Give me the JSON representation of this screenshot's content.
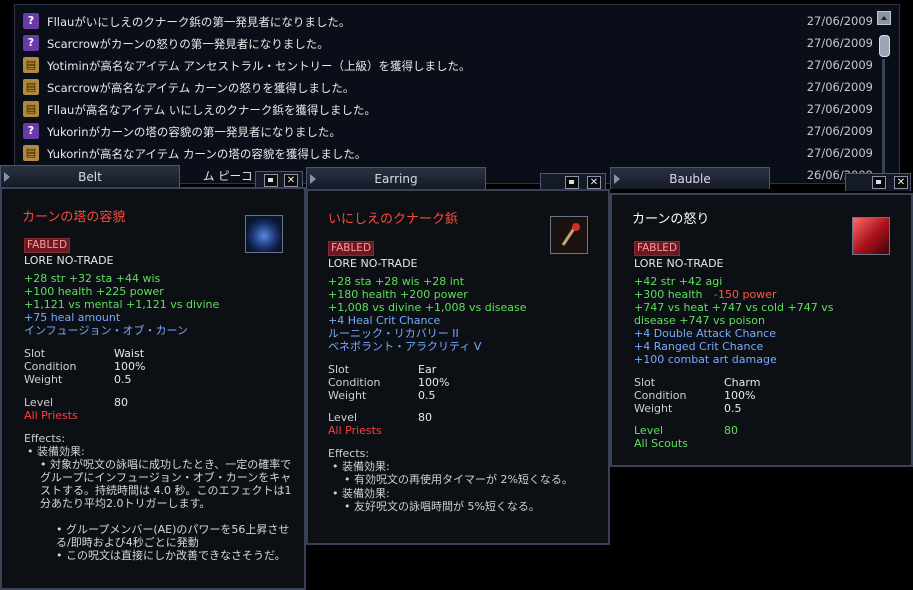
{
  "chat": {
    "rows": [
      {
        "icon": "quest",
        "text": "Fllauがいにしえのクナーク鋲の第一発見者になりました。",
        "date": "27/06/2009"
      },
      {
        "icon": "quest",
        "text": "Scarcrowがカーンの怒りの第一発見者になりました。",
        "date": "27/06/2009"
      },
      {
        "icon": "book",
        "text": "Yotiminが高名なアイテム アンセストラル・セントリー（上級）を獲得しました。",
        "date": "27/06/2009"
      },
      {
        "icon": "book",
        "text": "Scarcrowが高名なアイテム カーンの怒りを獲得しました。",
        "date": "27/06/2009"
      },
      {
        "icon": "book",
        "text": "Fllauが高名なアイテム いにしえのクナーク鋲を獲得しました。",
        "date": "27/06/2009"
      },
      {
        "icon": "quest",
        "text": "Yukorinがカーンの塔の容貌の第一発見者になりました。",
        "date": "27/06/2009"
      },
      {
        "icon": "book",
        "text": "Yukorinが高名なアイテム カーンの塔の容貌を獲得しました。",
        "date": "27/06/2009"
      },
      {
        "icon": "book",
        "text": "ム ピーコ",
        "date": "26/06/2009"
      }
    ]
  },
  "belt": {
    "title": "Belt",
    "name": "カーンの塔の容貌",
    "fabled": "FABLED",
    "lore": "LORE  NO-TRADE",
    "stats1": "+28 str  +32 sta  +44 wis",
    "stats2": "+100 health  +225 power",
    "stats3": "+1,121 vs mental  +1,121 vs divine",
    "stats4": "+75 heal amount",
    "spell": "インフュージョン・オブ・カーン",
    "slot_label": "Slot",
    "slot_value": "Waist",
    "cond_label": "Condition",
    "cond_value": "100%",
    "weight_label": "Weight",
    "weight_value": "0.5",
    "level_label": "Level",
    "level_value": "80",
    "classes": "All Priests",
    "effects_label": "Effects:",
    "effect_head": "• 装備効果:",
    "effect_1": "• 対象が呪文の詠唱に成功したとき、一定の確率でグループにインフュージョン・オブ・カーンをキャストする。持続時間は 4.0 秒。このエフェクトは1分あたり平均2.0トリガーします。",
    "effect_2": "• グループメンバー(AE)のパワーを56上昇させる/即時および4秒ごとに発動",
    "effect_3": "• この呪文は直接にしか改善できなさそうだ。"
  },
  "earring": {
    "title": "Earring",
    "name": "いにしえのクナーク鋲",
    "fabled": "FABLED",
    "lore": "LORE  NO-TRADE",
    "stats1": "+28 sta  +28 wis  +28 int",
    "stats2": "+180 health  +200 power",
    "stats3": "+1,008 vs divine  +1,008 vs disease",
    "stats4": "+4 Heal Crit Chance",
    "spell1": "ルーニック・リカバリー II",
    "spell2": "ベネボラント・アラクリティ V",
    "slot_label": "Slot",
    "slot_value": "Ear",
    "cond_label": "Condition",
    "cond_value": "100%",
    "weight_label": "Weight",
    "weight_value": "0.5",
    "level_label": "Level",
    "level_value": "80",
    "classes": "All Priests",
    "effects_label": "Effects:",
    "effect_head1": "• 装備効果:",
    "effect_1": "• 有効呪文の再使用タイマーが 2%短くなる。",
    "effect_head2": "• 装備効果:",
    "effect_2": "• 友好呪文の詠唱時間が 5%短くなる。"
  },
  "bauble": {
    "title": "Bauble",
    "name": "カーンの怒り",
    "fabled": "FABLED",
    "lore": "LORE  NO-TRADE",
    "stats1a": "+42 str  +42 agi",
    "stats2a": "+300 health",
    "stats2b": "-150 power",
    "stats3": "+747 vs heat  +747 vs cold  +747 vs",
    "stats4": "disease  +747 vs poison",
    "stats5": "+4 Double Attack Chance",
    "stats6": "+4 Ranged Crit Chance",
    "stats7": "+100 combat art damage",
    "slot_label": "Slot",
    "slot_value": "Charm",
    "cond_label": "Condition",
    "cond_value": "100%",
    "weight_label": "Weight",
    "weight_value": "0.5",
    "level_label": "Level",
    "level_value": "80",
    "classes": "All Scouts"
  },
  "colors": {
    "fabled": "#ff9a9a",
    "stat_green": "#5ee05a",
    "stat_blue": "#7aaaff",
    "name_red": "#ff4a3a"
  }
}
